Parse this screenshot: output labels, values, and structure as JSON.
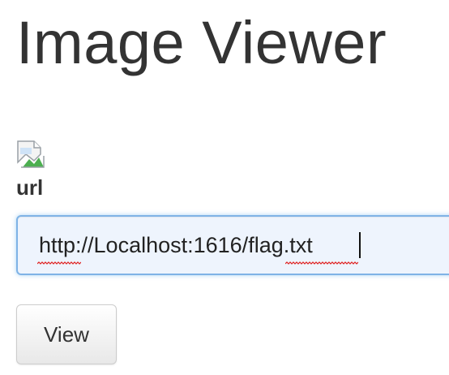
{
  "header": {
    "title": "Image Viewer"
  },
  "image": {
    "icon": "broken-image-icon"
  },
  "form": {
    "url_label": "url",
    "url_value": "http://Localhost:1616/flag.txt",
    "view_button_label": "View"
  },
  "colors": {
    "input_focus_border": "#7fb3e6",
    "input_background": "#eef4fd",
    "spellcheck_underline": "#e02020"
  }
}
